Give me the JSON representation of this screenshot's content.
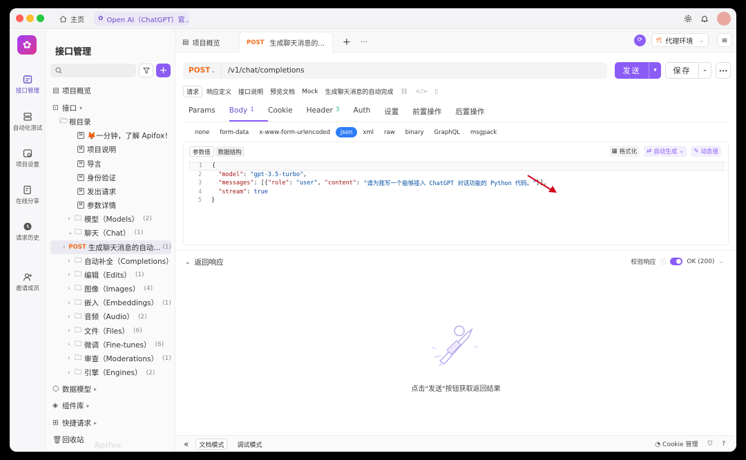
{
  "titlebar": {
    "home_label": "主页",
    "tab_label": "Open AI（ChatGPT）官...",
    "tab_close": "×"
  },
  "rail": {
    "items": [
      {
        "label": "接口管理",
        "icon": "api-icon"
      },
      {
        "label": "自动化测试",
        "icon": "automation-icon"
      },
      {
        "label": "项目设置",
        "icon": "settings-icon"
      },
      {
        "label": "在线分享",
        "icon": "share-icon"
      },
      {
        "label": "请求历史",
        "icon": "history-icon"
      },
      {
        "label": "邀请成员",
        "icon": "invite-icon"
      }
    ]
  },
  "sidebar": {
    "title": "接口管理",
    "search_placeholder": "",
    "overview": "项目概览",
    "interfaces": "接口",
    "root": "根目录",
    "docs": [
      "🦊一分钟，了解 Apifox！",
      "项目说明",
      "导言",
      "身份验证",
      "发出请求",
      "参数详情"
    ],
    "folders": [
      {
        "label": "模型（Models）",
        "count": "(2)"
      },
      {
        "label": "聊天（Chat）",
        "count": "(1)"
      }
    ],
    "selected_item": {
      "method": "POST",
      "label": "生成聊天消息的自动...",
      "count": "(1)"
    },
    "folders2": [
      {
        "label": "自动补全（Completions）",
        "count": "(1)"
      },
      {
        "label": "编辑（Edits）",
        "count": "(1)"
      },
      {
        "label": "图像（Images）",
        "count": "(4)"
      },
      {
        "label": "嵌入（Embeddings）",
        "count": "(1)"
      },
      {
        "label": "音频（Audio）",
        "count": "(2)"
      },
      {
        "label": "文件（Files）",
        "count": "(6)"
      },
      {
        "label": "微调（Fine-tunes）",
        "count": "(6)"
      },
      {
        "label": "审查（Moderations）",
        "count": "(1)"
      },
      {
        "label": "引擎（Engines）",
        "count": "(2)"
      }
    ],
    "data_models": "数据模型",
    "components": "组件库",
    "shortcuts": "快捷请求",
    "trash": "回收站",
    "watermark": "Apifox"
  },
  "main": {
    "tabs": [
      {
        "label": "项目概览"
      },
      {
        "method": "POST",
        "label": "生成聊天消息的..."
      }
    ],
    "tab_add": "+",
    "tab_more": "···",
    "env_badge": "代",
    "env_label": "代理环境",
    "method": "POST",
    "url": "/v1/chat/completions",
    "send": "发送",
    "save": "保存",
    "subtabs": [
      "请求",
      "响应定义",
      "接口说明",
      "预览文档",
      "Mock"
    ],
    "subtab_title": "生成聊天消息的自动完成",
    "reqtabs": [
      {
        "label": "Params",
        "count": ""
      },
      {
        "label": "Body",
        "count": "1"
      },
      {
        "label": "Cookie",
        "count": ""
      },
      {
        "label": "Header",
        "count": "3"
      },
      {
        "label": "Auth",
        "count": ""
      },
      {
        "label": "设置",
        "count": ""
      },
      {
        "label": "前置操作",
        "count": ""
      },
      {
        "label": "后置操作",
        "count": ""
      }
    ],
    "body_types": [
      "none",
      "form-data",
      "x-www-form-urlencoded",
      "json",
      "xml",
      "raw",
      "binary",
      "GraphQL",
      "msgpack"
    ],
    "editor_tabs": [
      "参数值",
      "数据结构"
    ],
    "editor_tools": [
      "格式化",
      "自动生成",
      "动态值"
    ],
    "code": {
      "line_numbers": [
        "1",
        "2",
        "3",
        "4",
        "5"
      ],
      "open_brace": "{",
      "model_key": "\"model\"",
      "model_val": "\"gpt-3.5-turbo\"",
      "messages_key": "\"messages\"",
      "role_key": "\"role\"",
      "role_val": "\"user\"",
      "content_key": "\"content\"",
      "content_val": "\"请为我写一个能够接入 ChatGPT 对话功能的 Python 代码。\"",
      "stream_key": "\"stream\"",
      "stream_val": "true",
      "close_brace": "}"
    },
    "response": {
      "title": "返回响应",
      "validate_label": "校验响应",
      "status": "OK (200)",
      "empty_text": "点击\"发送\"按钮获取返回结果"
    },
    "bottom": {
      "doc_mode": "文档模式",
      "debug_mode": "调试模式",
      "cookie_manage": "Cookie 管理"
    }
  },
  "colors": {
    "accent": "#8b5cf6",
    "post": "#f06c1c",
    "json_active": "#2e7cf6",
    "arrow": "#d0021b"
  }
}
